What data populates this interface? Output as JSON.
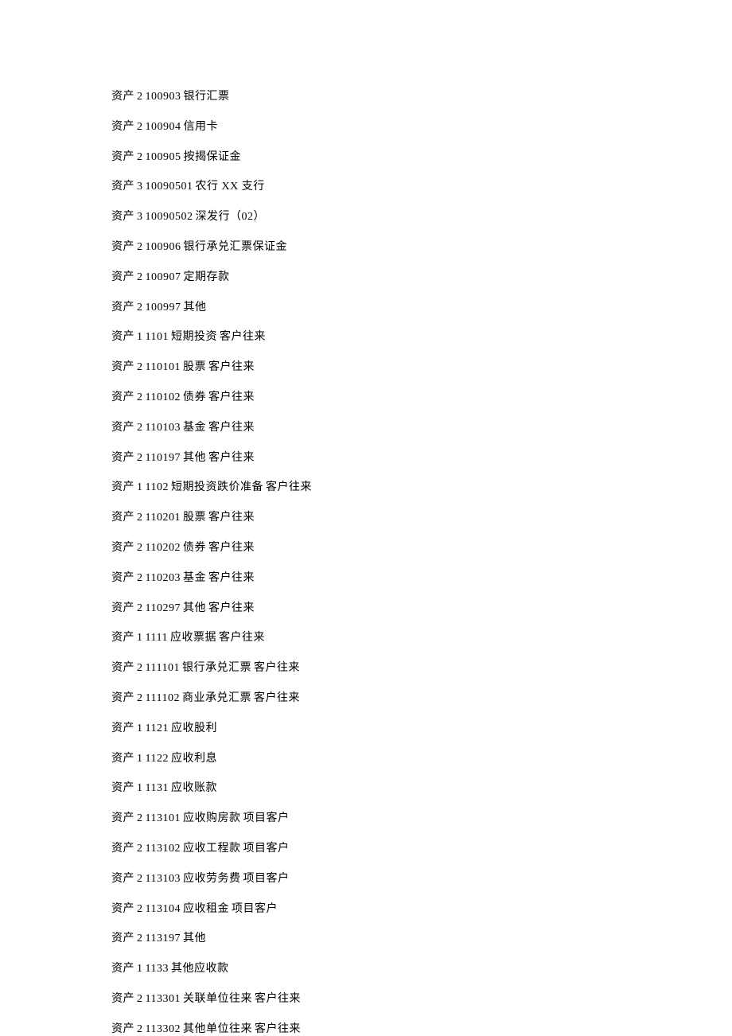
{
  "lines": [
    {
      "cat": "资产",
      "level": "2",
      "code": "100903",
      "name": "银行汇票",
      "extra": ""
    },
    {
      "cat": "资产",
      "level": "2",
      "code": "100904",
      "name": "信用卡",
      "extra": ""
    },
    {
      "cat": "资产",
      "level": "2",
      "code": "100905",
      "name": "按揭保证金",
      "extra": ""
    },
    {
      "cat": "资产",
      "level": "3",
      "code": "10090501",
      "name": "农行 XX 支行",
      "extra": ""
    },
    {
      "cat": "资产",
      "level": "3",
      "code": "10090502",
      "name": "深发行（02）",
      "extra": ""
    },
    {
      "cat": "资产",
      "level": "2",
      "code": "100906",
      "name": "银行承兑汇票保证金",
      "extra": ""
    },
    {
      "cat": "资产",
      "level": "2",
      "code": "100907",
      "name": "定期存款",
      "extra": ""
    },
    {
      "cat": "资产",
      "level": "2",
      "code": "100997",
      "name": "其他",
      "extra": ""
    },
    {
      "cat": "资产",
      "level": "1",
      "code": "1101",
      "name": "短期投资",
      "extra": "客户往来"
    },
    {
      "cat": "资产",
      "level": "2",
      "code": "110101",
      "name": "股票",
      "extra": "客户往来"
    },
    {
      "cat": "资产",
      "level": "2",
      "code": "110102",
      "name": "债券",
      "extra": "客户往来"
    },
    {
      "cat": "资产",
      "level": "2",
      "code": "110103",
      "name": "基金",
      "extra": "客户往来"
    },
    {
      "cat": "资产",
      "level": "2",
      "code": "110197",
      "name": "其他",
      "extra": "客户往来"
    },
    {
      "cat": "资产",
      "level": "1",
      "code": "1102",
      "name": "短期投资跌价准备",
      "extra": "客户往来"
    },
    {
      "cat": "资产",
      "level": "2",
      "code": "110201",
      "name": "股票",
      "extra": "客户往来"
    },
    {
      "cat": "资产",
      "level": "2",
      "code": "110202",
      "name": "债券",
      "extra": "客户往来"
    },
    {
      "cat": "资产",
      "level": "2",
      "code": "110203",
      "name": "基金",
      "extra": "客户往来"
    },
    {
      "cat": "资产",
      "level": "2",
      "code": "110297",
      "name": "其他",
      "extra": "客户往来"
    },
    {
      "cat": "资产",
      "level": "1",
      "code": "1111",
      "name": "应收票据",
      "extra": "客户往来"
    },
    {
      "cat": "资产",
      "level": "2",
      "code": "111101",
      "name": "银行承兑汇票",
      "extra": "客户往来"
    },
    {
      "cat": "资产",
      "level": "2",
      "code": "111102",
      "name": "商业承兑汇票",
      "extra": "客户往来"
    },
    {
      "cat": "资产",
      "level": "1",
      "code": "1121",
      "name": "应收股利",
      "extra": ""
    },
    {
      "cat": "资产",
      "level": "1",
      "code": "1122",
      "name": "应收利息",
      "extra": ""
    },
    {
      "cat": "资产",
      "level": "1",
      "code": "1131",
      "name": "应收账款",
      "extra": ""
    },
    {
      "cat": "资产",
      "level": "2",
      "code": "113101",
      "name": "应收购房款",
      "extra": "项目客户"
    },
    {
      "cat": "资产",
      "level": "2",
      "code": "113102",
      "name": "应收工程款",
      "extra": "项目客户"
    },
    {
      "cat": "资产",
      "level": "2",
      "code": "113103",
      "name": "应收劳务费",
      "extra": "项目客户"
    },
    {
      "cat": "资产",
      "level": "2",
      "code": "113104",
      "name": "应收租金",
      "extra": "项目客户"
    },
    {
      "cat": "资产",
      "level": "2",
      "code": "113197",
      "name": "其他",
      "extra": ""
    },
    {
      "cat": "资产",
      "level": "1",
      "code": "1133",
      "name": "其他应收款",
      "extra": ""
    },
    {
      "cat": "资产",
      "level": "2",
      "code": "113301",
      "name": "关联单位往来",
      "extra": "客户往来"
    },
    {
      "cat": "资产",
      "level": "2",
      "code": "113302",
      "name": "其他单位往来",
      "extra": "客户往来"
    }
  ]
}
